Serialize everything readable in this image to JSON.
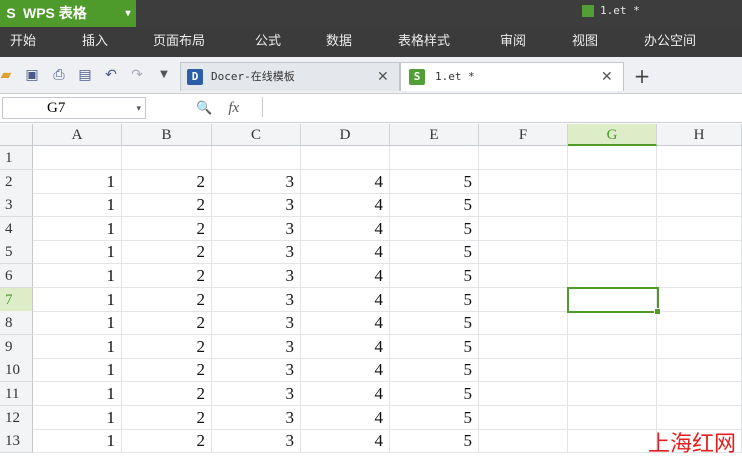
{
  "app": {
    "logo_glyph": "S",
    "name": "WPS 表格",
    "dropdown": "▾",
    "document_title": "1.et *"
  },
  "menu": [
    "开始",
    "插入",
    "页面布局",
    "公式",
    "数据",
    "表格样式",
    "审阅",
    "视图",
    "办公空间"
  ],
  "tabs": [
    {
      "label": "Docer-在线模板",
      "icon_text": "D",
      "icon_color": "#2a5fa8",
      "close": "✕"
    },
    {
      "label": "1.et *",
      "icon_text": "S",
      "icon_color": "#52a035",
      "close": "✕"
    }
  ],
  "new_tab": "+",
  "formula_bar": {
    "name_box": "G7",
    "fx_label": "fx",
    "value": ""
  },
  "columns": [
    "A",
    "B",
    "C",
    "D",
    "E",
    "F",
    "G",
    "H"
  ],
  "rows": [
    "1",
    "2",
    "3",
    "4",
    "5",
    "6",
    "7",
    "8",
    "9",
    "10",
    "11",
    "12",
    "13"
  ],
  "grid": [
    [
      "",
      "",
      "",
      "",
      "",
      "",
      "",
      ""
    ],
    [
      "1",
      "2",
      "3",
      "4",
      "5",
      "",
      "",
      ""
    ],
    [
      "1",
      "2",
      "3",
      "4",
      "5",
      "",
      "",
      ""
    ],
    [
      "1",
      "2",
      "3",
      "4",
      "5",
      "",
      "",
      ""
    ],
    [
      "1",
      "2",
      "3",
      "4",
      "5",
      "",
      "",
      ""
    ],
    [
      "1",
      "2",
      "3",
      "4",
      "5",
      "",
      "",
      ""
    ],
    [
      "1",
      "2",
      "3",
      "4",
      "5",
      "",
      "",
      ""
    ],
    [
      "1",
      "2",
      "3",
      "4",
      "5",
      "",
      "",
      ""
    ],
    [
      "1",
      "2",
      "3",
      "4",
      "5",
      "",
      "",
      ""
    ],
    [
      "1",
      "2",
      "3",
      "4",
      "5",
      "",
      "",
      ""
    ],
    [
      "1",
      "2",
      "3",
      "4",
      "5",
      "",
      "",
      ""
    ],
    [
      "1",
      "2",
      "3",
      "4",
      "5",
      "",
      "",
      ""
    ],
    [
      "1",
      "2",
      "3",
      "4",
      "5",
      "",
      "",
      ""
    ]
  ],
  "selected": {
    "column": "G",
    "row": "7"
  },
  "toolbar_icons": [
    "open-icon",
    "save-icon",
    "print-icon",
    "print-preview-icon",
    "undo-icon",
    "redo-icon",
    "more-icon"
  ],
  "watermark": "上海红网",
  "colors": {
    "accent": "#4e9a2a",
    "menubar": "#3b3b3b",
    "watermark": "#e41e1e"
  }
}
